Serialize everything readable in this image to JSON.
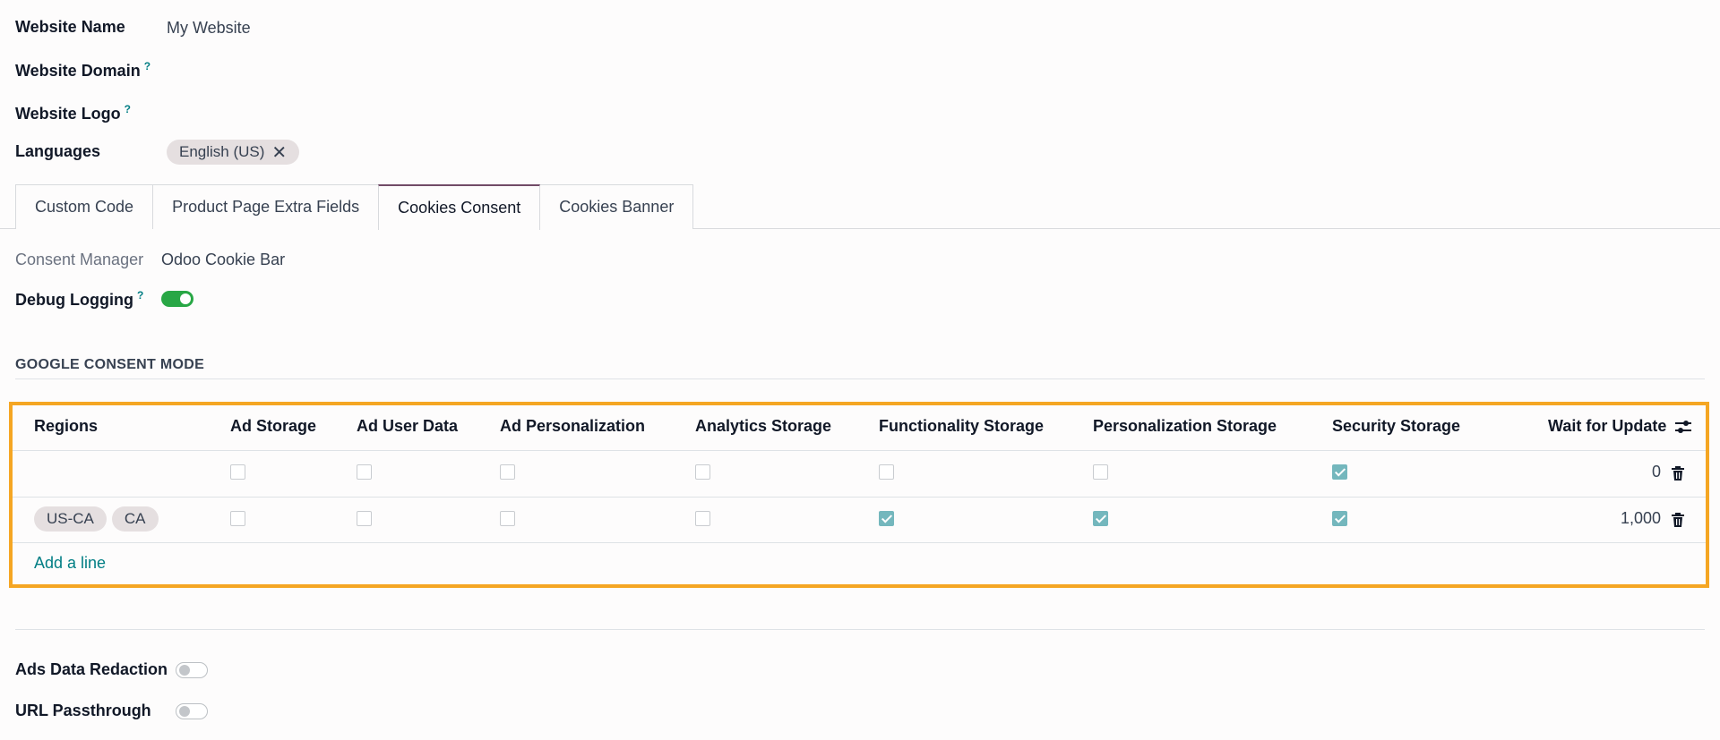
{
  "website": {
    "name_label": "Website Name",
    "name_value": "My Website",
    "domain_label": "Website Domain",
    "domain_help": "?",
    "logo_label": "Website Logo",
    "logo_help": "?",
    "languages_label": "Languages",
    "languages": [
      "English (US)"
    ]
  },
  "tabs": [
    {
      "label": "Custom Code",
      "active": false
    },
    {
      "label": "Product Page Extra Fields",
      "active": false
    },
    {
      "label": "Cookies Consent",
      "active": true
    },
    {
      "label": "Cookies Banner",
      "active": false
    }
  ],
  "cookies": {
    "consent_manager_label": "Consent Manager",
    "consent_manager_value": "Odoo Cookie Bar",
    "debug_logging_label": "Debug Logging",
    "debug_logging_help": "?",
    "debug_logging_on": true
  },
  "google_consent": {
    "section_title": "GOOGLE CONSENT MODE",
    "columns": [
      "Regions",
      "Ad Storage",
      "Ad User Data",
      "Ad Personalization",
      "Analytics Storage",
      "Functionality Storage",
      "Personalization Storage",
      "Security Storage",
      "Wait for Update"
    ],
    "rows": [
      {
        "regions": [],
        "checks": [
          false,
          false,
          false,
          false,
          false,
          false,
          true
        ],
        "wait": "0"
      },
      {
        "regions": [
          "US-CA",
          "CA"
        ],
        "checks": [
          false,
          false,
          false,
          false,
          true,
          true,
          true
        ],
        "wait": "1,000"
      }
    ],
    "add_line": "Add a line",
    "highlight_color": "#f5a623",
    "check_color": "#74b7bd"
  },
  "bottom": {
    "ads_data_redaction_label": "Ads Data Redaction",
    "ads_data_redaction_on": false,
    "url_passthrough_label": "URL Passthrough",
    "url_passthrough_on": false
  },
  "icons": [
    "close-icon",
    "trash-icon",
    "optional-columns-icon",
    "help-icon"
  ]
}
